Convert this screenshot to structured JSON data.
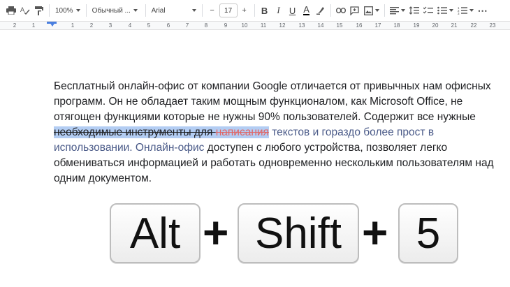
{
  "toolbar": {
    "zoom": "100%",
    "style": "Обычный ...",
    "font": "Arial",
    "font_size": "17",
    "minus": "−",
    "plus": "+",
    "bold": "B",
    "italic": "I",
    "underline": "U",
    "text_color": "A",
    "more": "⋯"
  },
  "ruler": {
    "numbers": [
      "2",
      "1",
      "1",
      "2",
      "3",
      "4",
      "5",
      "6",
      "7",
      "8",
      "9",
      "10",
      "11",
      "12",
      "13",
      "14",
      "15",
      "16",
      "17",
      "18",
      "19",
      "20",
      "21",
      "22",
      "23"
    ]
  },
  "document": {
    "line1": "Бесплатный онлайн-офис от компании Google отличается от привычных нам офисных",
    "line2": "программ. Он не обладает таким мощным функционалом, как Microsoft Office, не",
    "line3": "отягощен функциями которые не нужны 90% пользователей. Содержит все нужные",
    "line4_strike": "необходимые инструменты для ",
    "line4_strike_red": "написания",
    "line4_blue": " текстов и гораздо более прост в",
    "line5_blue": "использовании. Онлайн-офис",
    "line5_rest": " доступен с любого устройства, позволяет легко",
    "line6": "обмениваться информацией и работать одновременно нескольким пользователям над",
    "line7": "одним документом."
  },
  "shortcut": {
    "key1": "Alt",
    "plus1": "+",
    "key2": "Shift",
    "plus2": "+",
    "key3": "5"
  },
  "colors": {
    "selection": "#b3cdf3",
    "strike_red": "#e06666",
    "link_blue": "#4a5a88",
    "ruler_marker": "#4a7fe0"
  }
}
